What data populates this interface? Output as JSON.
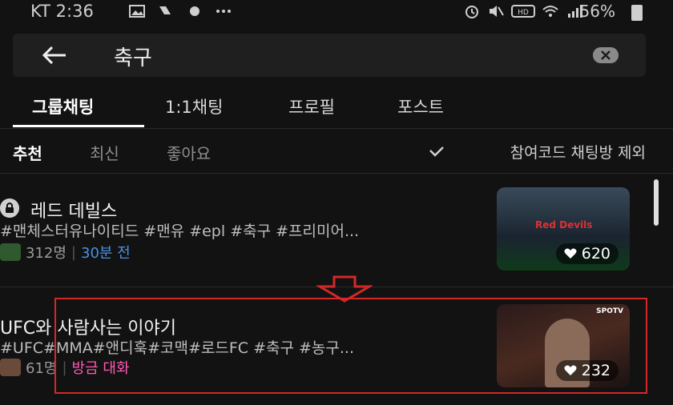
{
  "status_bar": {
    "carrier_time": "KT 2:36",
    "battery": "56%"
  },
  "search": {
    "query": "축구"
  },
  "tabs": [
    {
      "label": "그룹채팅",
      "active": true
    },
    {
      "label": "1:1채팅",
      "active": false
    },
    {
      "label": "프로필",
      "active": false
    },
    {
      "label": "포스트",
      "active": false
    }
  ],
  "filters": {
    "items": [
      "추천",
      "최신",
      "좋아요"
    ],
    "exclude_label": "참여코드 채팅방 제외"
  },
  "results": [
    {
      "title": "레드 데빌스",
      "tags": "#맨체스터유나이티드 #맨유 #epl #축구 #프리미어...",
      "members": "312명",
      "activity": "30분 전",
      "likes": "620",
      "thumb_text": "Red Devils"
    },
    {
      "title": "UFC와 사람사는 이야기",
      "tags": "#UFC#MMA#앤디훅#코맥#로드FC #축구 #농구...",
      "members": "61명",
      "activity": "방금 대화",
      "likes": "232",
      "thumb_text": "SPOTV"
    }
  ],
  "colors": {
    "accent_blue": "#4a90e2",
    "accent_pink": "#ff5ab4",
    "highlight_red": "#d42828"
  }
}
